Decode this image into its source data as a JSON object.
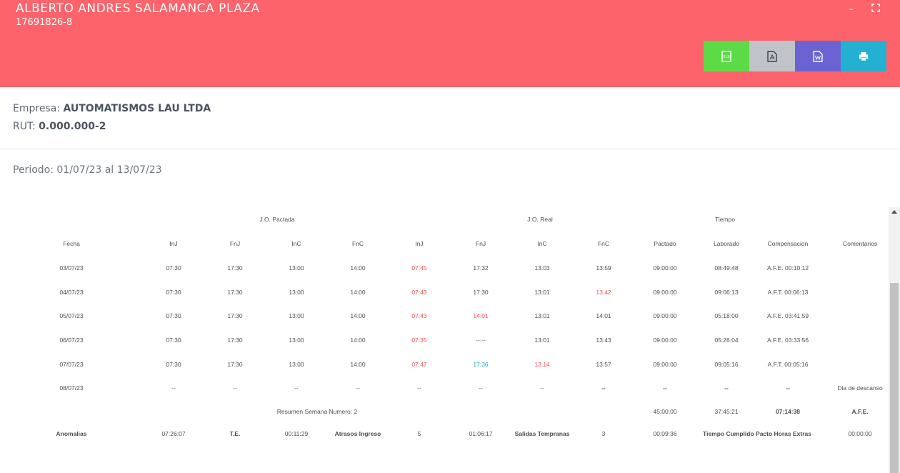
{
  "header": {
    "employee_name": "ALBERTO ANDRES SALAMANCA PLAZA",
    "employee_id": "17691826-8",
    "minimize_glyph": "–",
    "fullscreen_glyph": "⛶",
    "buttons": [
      {
        "name": "excel-export-button",
        "icon": "xls-file-icon",
        "color": "#5cdb46"
      },
      {
        "name": "pdf-export-button",
        "icon": "pdf-file-icon",
        "color": "#c0c3c9"
      },
      {
        "name": "word-export-button",
        "icon": "word-file-icon",
        "color": "#6b63d3"
      },
      {
        "name": "print-button",
        "icon": "printer-icon",
        "color": "#22b1d0"
      }
    ]
  },
  "company": {
    "empresa_label": "Empresa:",
    "empresa_value": "AUTOMATISMOS LAU LTDA",
    "rut_label": "RUT:",
    "rut_value": "0.000.000-2"
  },
  "periodo": "Periodo: 01/07/23 al 13/07/23",
  "table": {
    "groups": {
      "pactada": "J.O. Pactada",
      "real": "J.O. Real",
      "tiempo": "Tiempo"
    },
    "columns": [
      "Fecha",
      "InJ",
      "FnJ",
      "InC",
      "FnC",
      "InJ",
      "FnJ",
      "InC",
      "FnC",
      "Pactado",
      "Laborado",
      "Compensacion",
      "Comentarios"
    ],
    "rows": [
      {
        "cells": [
          "03/07/23",
          "07:30",
          "17:30",
          "13:00",
          "14:00",
          "07:45",
          "17:32",
          "13:03",
          "13:59",
          "09:00:00",
          "08:49:48",
          "A.F.E. 00:10:12",
          ""
        ],
        "colors": [
          "",
          "",
          "",
          "",
          "",
          "red",
          "",
          "",
          "",
          "",
          "",
          "",
          ""
        ]
      },
      {
        "cells": [
          "04/07/23",
          "07:30",
          "17:30",
          "13:00",
          "14:00",
          "07:43",
          "17:30",
          "13:01",
          "13:42",
          "09:00:00",
          "09:06:13",
          "A.F.T. 00:06:13",
          ""
        ],
        "colors": [
          "",
          "",
          "",
          "",
          "",
          "red",
          "",
          "",
          "red",
          "",
          "",
          "",
          ""
        ]
      },
      {
        "cells": [
          "05/07/23",
          "07:30",
          "17:30",
          "13:00",
          "14:00",
          "07:43",
          "14:01",
          "13:01",
          "14:01",
          "09:00:00",
          "05:18:00",
          "A.F.E. 03:41:59",
          ""
        ],
        "colors": [
          "",
          "",
          "",
          "",
          "",
          "red",
          "red",
          "",
          "",
          "",
          "",
          "",
          ""
        ]
      },
      {
        "cells": [
          "06/07/23",
          "07:30",
          "17:30",
          "13:00",
          "14:00",
          "07:35",
          "--:--",
          "13:01",
          "13:43",
          "09:00:00",
          "05:26:04",
          "A.F.E. 03:33:56",
          ""
        ],
        "colors": [
          "",
          "",
          "",
          "",
          "",
          "red",
          "",
          "",
          "",
          "",
          "",
          "",
          ""
        ]
      },
      {
        "cells": [
          "07/07/23",
          "07:30",
          "17:30",
          "13:00",
          "14:00",
          "07:47",
          "17:36",
          "13:14",
          "13:57",
          "09:00:00",
          "09:05:16",
          "A.F.T. 00:05:16",
          ""
        ],
        "colors": [
          "",
          "",
          "",
          "",
          "",
          "red",
          "blue",
          "red",
          "",
          "",
          "",
          "",
          ""
        ]
      },
      {
        "cells": [
          "08/07/23",
          "--",
          "--",
          "--",
          "--",
          "--",
          "--",
          "--",
          "--",
          "--",
          "--",
          "--",
          "Dia de descanso"
        ],
        "colors": [
          "",
          "",
          "",
          "",
          "",
          "",
          "",
          "",
          "bold",
          "bold",
          "bold",
          "bold",
          ""
        ]
      }
    ],
    "summary": {
      "label": "Resumen Semana Numero: 2",
      "pactado": "45:00:00",
      "laborado": "37:45:21",
      "compensacion": "07:14:38",
      "comentarios": "A.F.E."
    },
    "anomalias": {
      "label": "Anomalias",
      "anomalias_value": "07:26:07",
      "te_label": "T.E.",
      "te_value": "00:11:29",
      "atrasos_label": "Atrasos Ingreso",
      "atrasos_count": "5",
      "atrasos_value": "01:06:17",
      "salidas_label": "Salidas Tempranas",
      "salidas_count": "3",
      "salidas_value": "00:09:36",
      "pacto_label": "Tiempo Cumplido Pacto Horas Extras",
      "pacto_value": "00:00:00"
    }
  }
}
